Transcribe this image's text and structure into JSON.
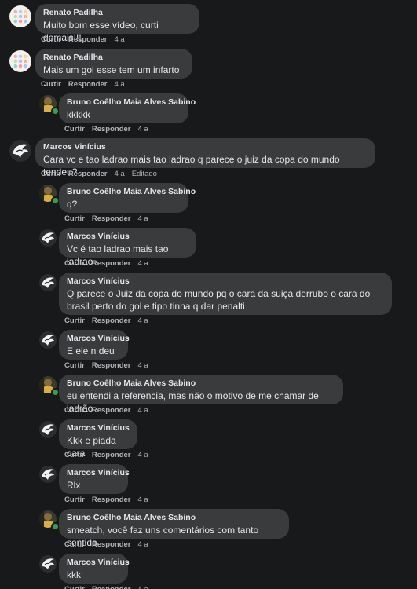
{
  "actions": {
    "like": "Curtir",
    "reply": "Responder",
    "edited": "Editado"
  },
  "comments": [
    {
      "author": "Renato Padilha",
      "text": "Muito bom esse vídeo, curti demais!!!",
      "time": "4 a",
      "avatar": "dots-avatar"
    },
    {
      "author": "Renato Padilha",
      "text": "Mais um gol esse tem um infarto ....",
      "time": "4 a",
      "avatar": "dots-avatar"
    },
    {
      "author": "Bruno Coêlho Maia Alves Sabino",
      "text": "kkkkk",
      "time": "4 a",
      "avatar": "photo-avatar",
      "online": true
    },
    {
      "author": "Marcos Vinícius",
      "text": "Cara vc e tao ladrao mais tao ladrao q parece o juiz da copa do mundo tendeu?",
      "time": "4 a",
      "avatar": "logo-avatar",
      "edited": true
    },
    {
      "author": "Bruno Coêlho Maia Alves Sabino",
      "text": "q?",
      "time": "4 a",
      "avatar": "photo-avatar",
      "online": true
    },
    {
      "author": "Marcos Vinícius",
      "text": "Vc é tao ladrao mais tao ladrao",
      "time": "4 a",
      "avatar": "logo-avatar"
    },
    {
      "author": "Marcos Vinícius",
      "text": "Q parece o Juiz da copa do mundo pq o cara da suiça derrubo o cara do brasil perto do gol e tipo tinha q dar penalti",
      "time": "4 a",
      "avatar": "logo-avatar"
    },
    {
      "author": "Marcos Vinícius",
      "text": "E ele n deu",
      "time": "4 a",
      "avatar": "logo-avatar"
    },
    {
      "author": "Bruno Coêlho Maia Alves Sabino",
      "text": "eu entendi a referencia, mas não o motivo de me chamar de ladrão",
      "time": "4 a",
      "avatar": "photo-avatar",
      "online": true
    },
    {
      "author": "Marcos Vinícius",
      "text": "Kkk e piada cara",
      "time": "4 a",
      "avatar": "logo-avatar"
    },
    {
      "author": "Marcos Vinícius",
      "text": "Rlx",
      "time": "4 a",
      "avatar": "logo-avatar"
    },
    {
      "author": "Bruno Coêlho Maia Alves Sabino",
      "text": "smeatch, você faz uns comentários com tanto sentido",
      "time": "4 a",
      "avatar": "photo-avatar",
      "online": true
    },
    {
      "author": "Marcos Vinícius",
      "text": "kkk",
      "time": "4 a",
      "avatar": "logo-avatar"
    }
  ],
  "colors": {
    "background": "#18191a",
    "bubble": "#3a3b3c",
    "text": "#e4e6eb",
    "meta": "#b0b3b8",
    "online": "#31a24c"
  }
}
